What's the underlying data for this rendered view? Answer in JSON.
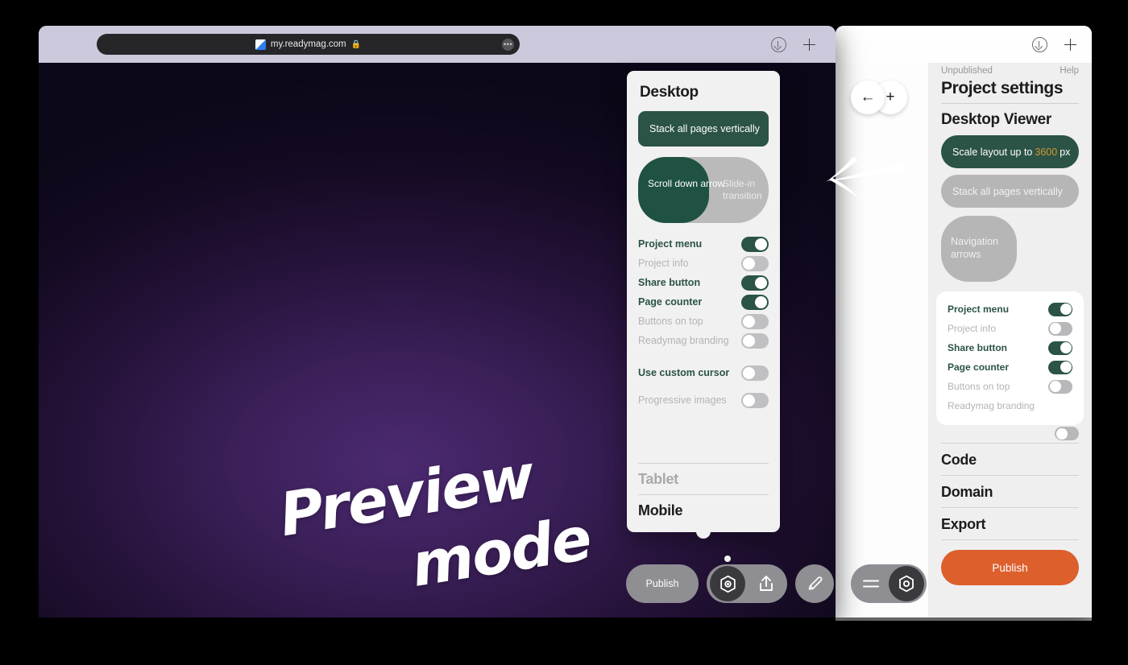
{
  "browser": {
    "front": {
      "url": "my.readymag.com",
      "lock_icon": "lock-icon",
      "favicon": "readymag-favicon",
      "more_dots": "•••",
      "download_icon": "download-icon",
      "newtab_icon": "plus-icon"
    },
    "back": {
      "download_icon": "download-icon",
      "newtab_icon": "plus-icon"
    }
  },
  "canvas": {
    "annotation_line1": "Preview",
    "annotation_line2": "mode",
    "bg_dark": "#140a22",
    "bg_purple": "#4b2a70"
  },
  "popover": {
    "title": "Desktop",
    "stack_pill": "Stack all pages vertically",
    "segment": {
      "left": "Scroll down arrow",
      "right": "Slide-in transition"
    },
    "toggles": [
      {
        "label": "Project menu",
        "state": "on"
      },
      {
        "label": "Project info",
        "state": "off"
      },
      {
        "label": "Share button",
        "state": "on"
      },
      {
        "label": "Page counter",
        "state": "on"
      },
      {
        "label": "Buttons on top",
        "state": "off"
      },
      {
        "label": "Readymag branding",
        "state": "off"
      }
    ],
    "toggles2": [
      {
        "label": "Use custom cursor",
        "state": "off"
      },
      {
        "label": "Progressive images",
        "state": "off"
      }
    ],
    "sections": [
      {
        "label": "Tablet",
        "active": false
      },
      {
        "label": "Mobile",
        "active": true
      }
    ]
  },
  "nav": {
    "back_arrow": "←",
    "plus": "+"
  },
  "settings": {
    "status": "Unpublished",
    "help": "Help",
    "title": "Project settings",
    "subtitle": "Desktop Viewer",
    "scale_pill": {
      "prefix": "Scale layout up to",
      "value": "3600",
      "suffix": "px"
    },
    "stack_pill": "Stack all pages vertically",
    "nav_blob": "Navigation arrows",
    "toggles": [
      {
        "label": "Project menu",
        "state": "on"
      },
      {
        "label": "Project info",
        "state": "off"
      },
      {
        "label": "Share button",
        "state": "on"
      },
      {
        "label": "Page counter",
        "state": "on"
      },
      {
        "label": "Buttons on top",
        "state": "off"
      },
      {
        "label": "Readymag branding",
        "state": "off"
      }
    ],
    "links": [
      "Code",
      "Domain",
      "Export"
    ],
    "publish": "Publish",
    "accent_green": "#2b5346",
    "accent_orange": "#dc5f2c",
    "accent_gold": "#d6972f"
  },
  "toolbar": {
    "publish": "Publish",
    "preview_icon": "eye-icon",
    "share_icon": "share-icon",
    "edit_icon": "pencil-icon",
    "menu_icon": "hamburger-icon",
    "settings_icon": "gear-eye-icon"
  }
}
